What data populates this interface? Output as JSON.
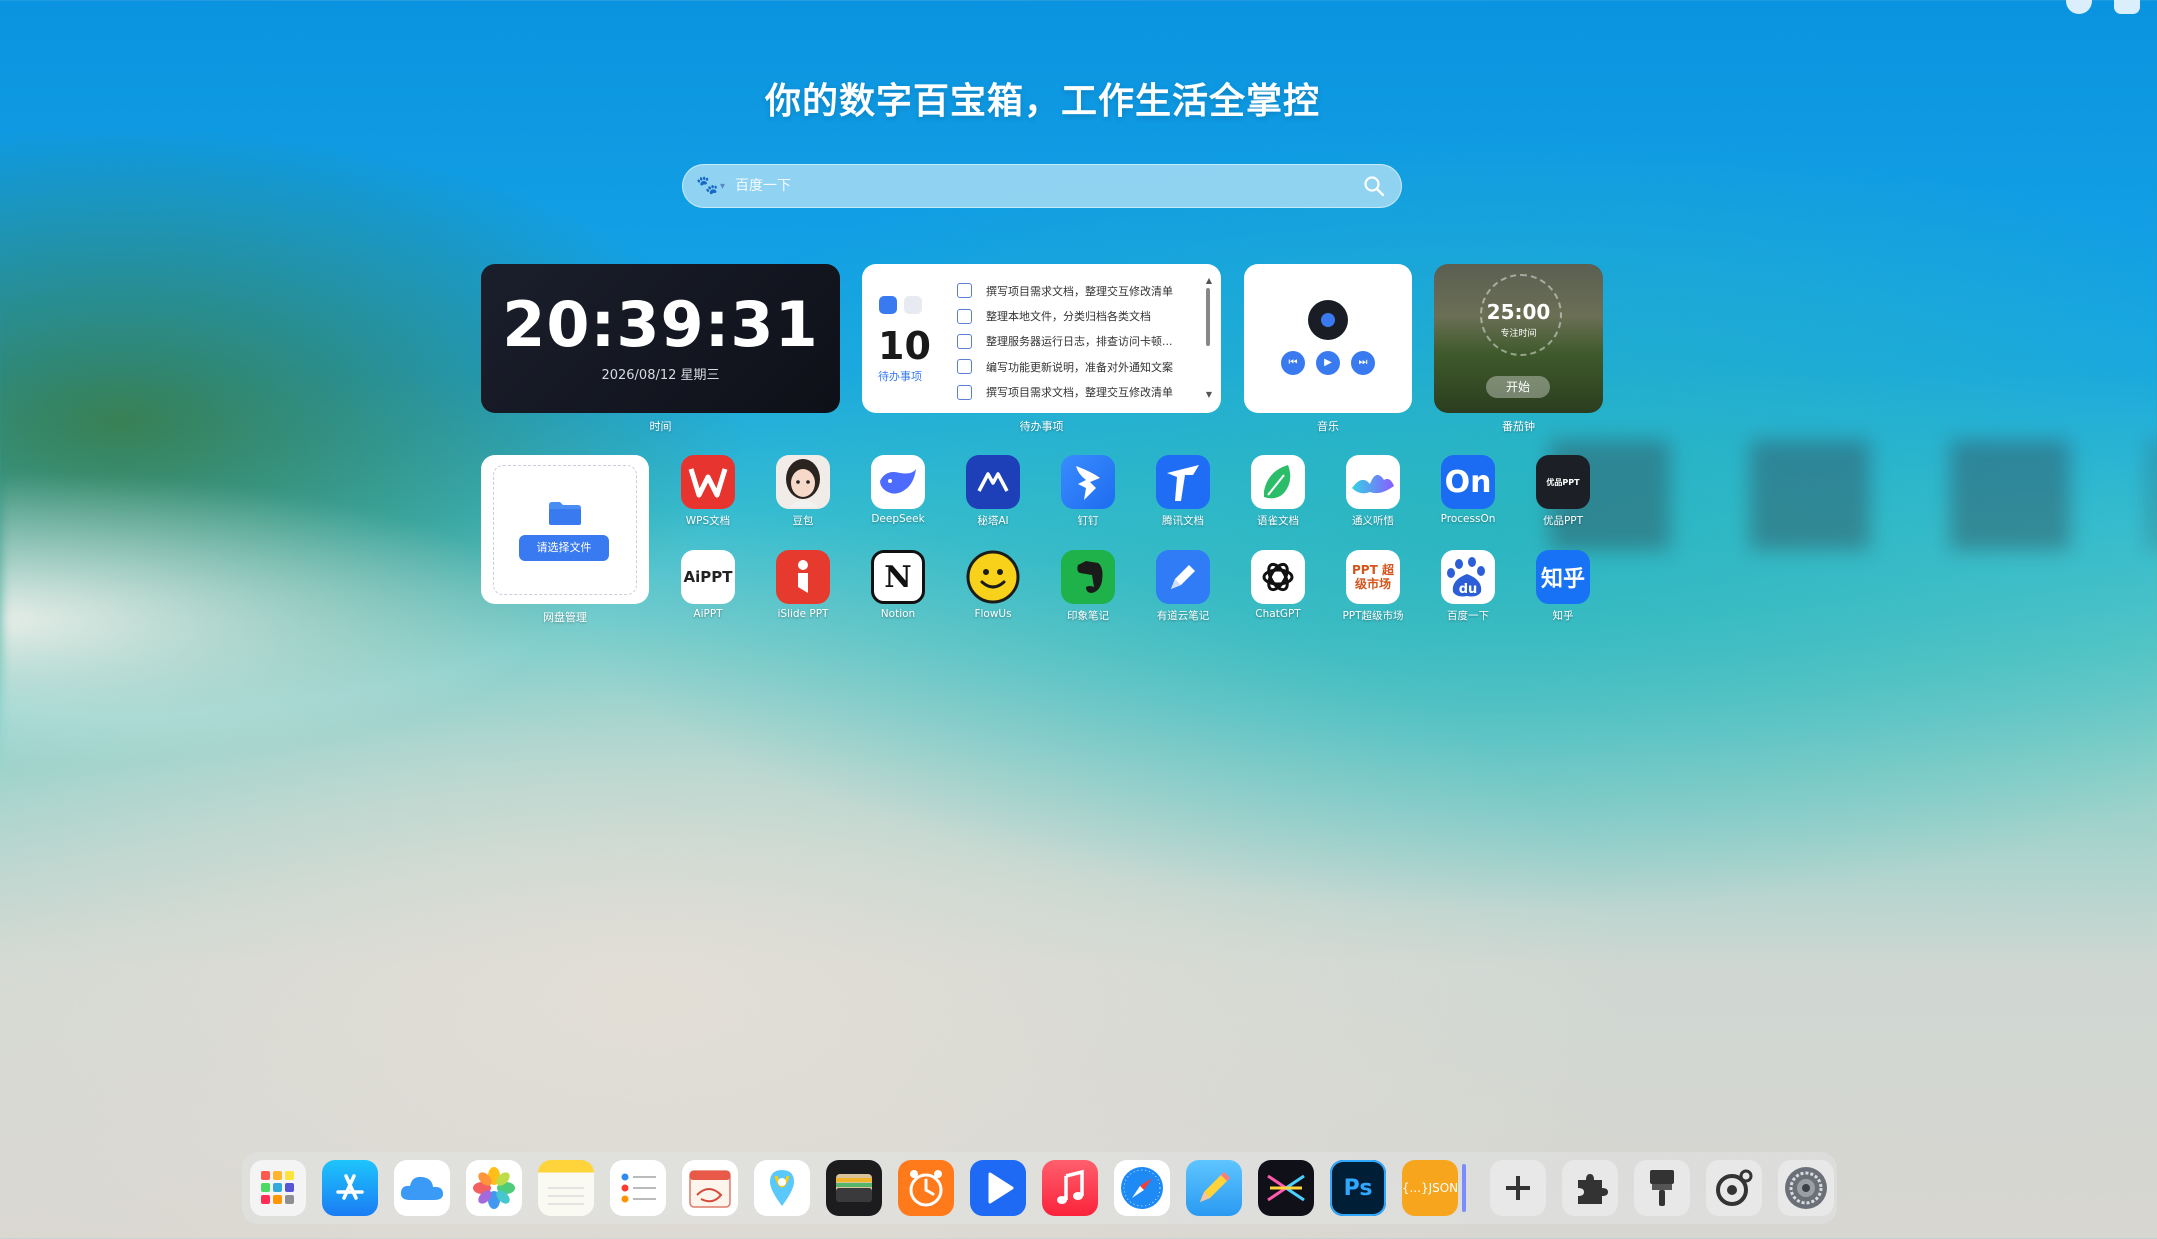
{
  "headline": "你的数字百宝箱，工作生活全掌控",
  "search": {
    "placeholder": "百度一下",
    "engine_icon": "baidu-paw-icon"
  },
  "widgets": {
    "clock": {
      "time": "20:39:31",
      "date": "2026/08/12 星期三",
      "label": "时间"
    },
    "todo": {
      "count": "10",
      "count_label": "待办事项",
      "label": "待办事项",
      "items": [
        "撰写项目需求文档，整理交互修改清单",
        "整理本地文件，分类归档各类文档",
        "整理服务器运行日志，排查访问卡顿...",
        "编写功能更新说明，准备对外通知文案",
        "撰写项目需求文档，整理交互修改清单"
      ]
    },
    "music": {
      "label": "音乐"
    },
    "pomodoro": {
      "time": "25:00",
      "sub": "专注时间",
      "start": "开始",
      "label": "番茄钟"
    },
    "disk": {
      "button": "请选择文件",
      "label": "网盘管理"
    }
  },
  "apps": [
    {
      "name": "WPS文档",
      "icon": "wps-icon"
    },
    {
      "name": "豆包",
      "icon": "doubao-icon"
    },
    {
      "name": "DeepSeek",
      "icon": "deepseek-whale-icon"
    },
    {
      "name": "秘塔AI",
      "icon": "metaso-icon"
    },
    {
      "name": "钉钉",
      "icon": "dingtalk-icon"
    },
    {
      "name": "腾讯文档",
      "icon": "tencent-docs-icon"
    },
    {
      "name": "语雀文档",
      "icon": "yuque-icon"
    },
    {
      "name": "通义听悟",
      "icon": "tongyi-icon"
    },
    {
      "name": "ProcessOn",
      "icon": "processon-icon",
      "text": "On"
    },
    {
      "name": "优品PPT",
      "icon": "youpin-ppt-icon",
      "text": "优品PPT"
    },
    {
      "name": "AiPPT",
      "icon": "aippt-icon",
      "text": "AiPPT"
    },
    {
      "name": "iSlide PPT",
      "icon": "islide-icon"
    },
    {
      "name": "Notion",
      "icon": "notion-icon",
      "text": "N"
    },
    {
      "name": "FlowUs",
      "icon": "flowus-icon"
    },
    {
      "name": "印象笔记",
      "icon": "evernote-icon"
    },
    {
      "name": "有道云笔记",
      "icon": "youdao-note-icon"
    },
    {
      "name": "ChatGPT",
      "icon": "chatgpt-icon"
    },
    {
      "name": "PPT超级市场",
      "icon": "ppt-market-icon",
      "text": "PPT 超级市场"
    },
    {
      "name": "百度一下",
      "icon": "baidu-icon",
      "text": "du"
    },
    {
      "name": "知乎",
      "icon": "zhihu-icon",
      "text": "知乎"
    }
  ],
  "dock": [
    {
      "icon": "launchpad-icon"
    },
    {
      "icon": "app-store-icon"
    },
    {
      "icon": "icloud-icon"
    },
    {
      "icon": "photos-icon"
    },
    {
      "icon": "notes-icon"
    },
    {
      "icon": "reminders-icon"
    },
    {
      "icon": "calendar-icon"
    },
    {
      "icon": "maps-icon"
    },
    {
      "icon": "wallet-icon"
    },
    {
      "icon": "clock-icon"
    },
    {
      "icon": "video-player-icon"
    },
    {
      "icon": "music-icon"
    },
    {
      "icon": "safari-icon"
    },
    {
      "icon": "pencil-icon"
    },
    {
      "icon": "vscode-like-icon"
    },
    {
      "icon": "photoshop-icon",
      "text": "Ps"
    },
    {
      "icon": "json-icon",
      "text": "{...}JSON"
    },
    {
      "icon": "add-icon"
    },
    {
      "icon": "extensions-icon"
    },
    {
      "icon": "brush-icon"
    },
    {
      "icon": "settings-gear-icon"
    },
    {
      "icon": "system-settings-icon"
    }
  ]
}
